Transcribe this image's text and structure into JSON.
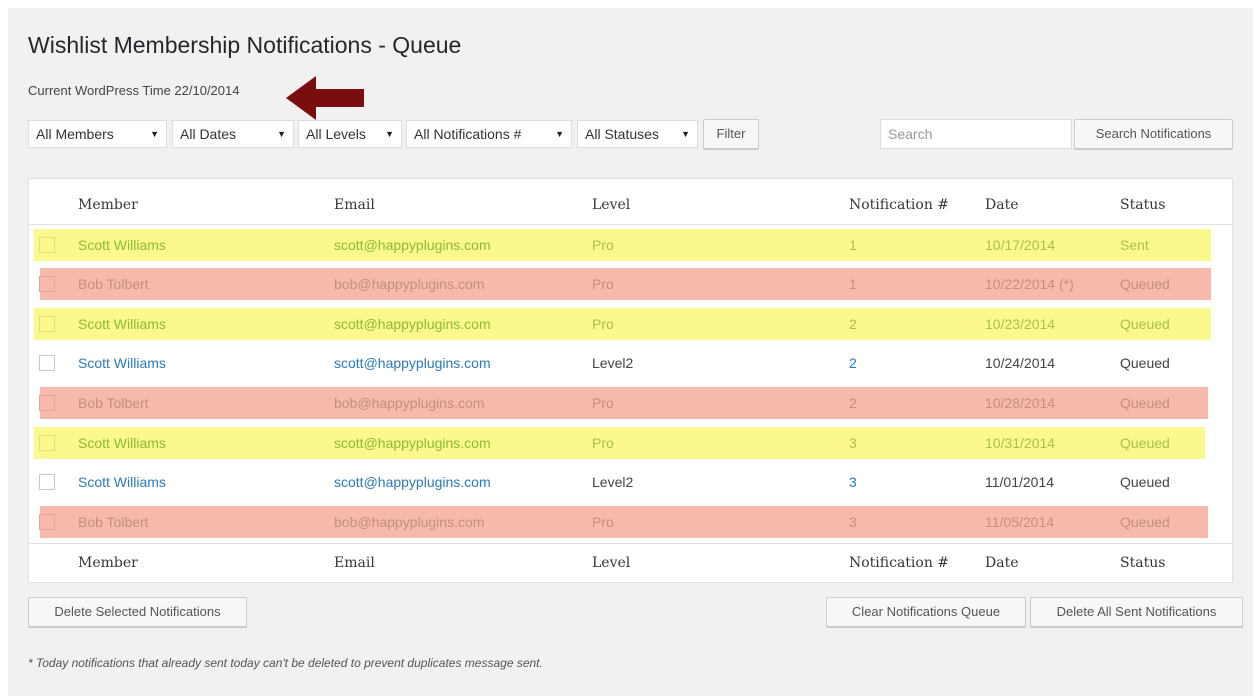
{
  "title": "Wishlist Membership Notifications - Queue",
  "wp_time": "Current WordPress Time 22/10/2014",
  "filters": [
    {
      "label": "All Members"
    },
    {
      "label": "All Dates"
    },
    {
      "label": "All Levels"
    },
    {
      "label": "All Notifications #"
    },
    {
      "label": "All Statuses"
    }
  ],
  "filter_button": "Filter",
  "search": {
    "placeholder": "Search",
    "button": "Search Notifications"
  },
  "columns": {
    "member": "Member",
    "email": "Email",
    "level": "Level",
    "notification": "Notification #",
    "date": "Date",
    "status": "Status"
  },
  "rows": [
    {
      "member": "Scott Williams",
      "email": "scott@happyplugins.com",
      "level": "Pro",
      "notification": "1",
      "date": "10/17/2014",
      "status": "Sent",
      "highlight": "yellow"
    },
    {
      "member": "Bob Tolbert",
      "email": "bob@happyplugins.com",
      "level": "Pro",
      "notification": "1",
      "date": "10/22/2014 (*)",
      "status": "Queued",
      "highlight": "red"
    },
    {
      "member": "Scott Williams",
      "email": "scott@happyplugins.com",
      "level": "Pro",
      "notification": "2",
      "date": "10/23/2014",
      "status": "Queued",
      "highlight": "yellow"
    },
    {
      "member": "Scott Williams",
      "email": "scott@happyplugins.com",
      "level": "Level2",
      "notification": "2",
      "date": "10/24/2014",
      "status": "Queued",
      "highlight": "none"
    },
    {
      "member": "Bob Tolbert",
      "email": "bob@happyplugins.com",
      "level": "Pro",
      "notification": "2",
      "date": "10/28/2014",
      "status": "Queued",
      "highlight": "red"
    },
    {
      "member": "Scott Williams",
      "email": "scott@happyplugins.com",
      "level": "Pro",
      "notification": "3",
      "date": "10/31/2014",
      "status": "Queued",
      "highlight": "yellow"
    },
    {
      "member": "Scott Williams",
      "email": "scott@happyplugins.com",
      "level": "Level2",
      "notification": "3",
      "date": "11/01/2014",
      "status": "Queued",
      "highlight": "none"
    },
    {
      "member": "Bob Tolbert",
      "email": "bob@happyplugins.com",
      "level": "Pro",
      "notification": "3",
      "date": "11/05/2014",
      "status": "Queued",
      "highlight": "red"
    }
  ],
  "buttons": {
    "delete_selected": "Delete Selected Notifications",
    "clear_queue": "Clear Notifications Queue",
    "delete_sent": "Delete All Sent Notifications"
  },
  "footnote": "* Today notifications that already sent today can't be deleted to prevent duplicates message sent.",
  "colors": {
    "yellow_row": "#fbf88d",
    "red_row": "#f6b9ac",
    "link": "#2a7bb8",
    "arrow": "#7a0e0e"
  },
  "icons": {
    "arrow": "left-arrow-icon",
    "caret": "caret-down-icon"
  }
}
